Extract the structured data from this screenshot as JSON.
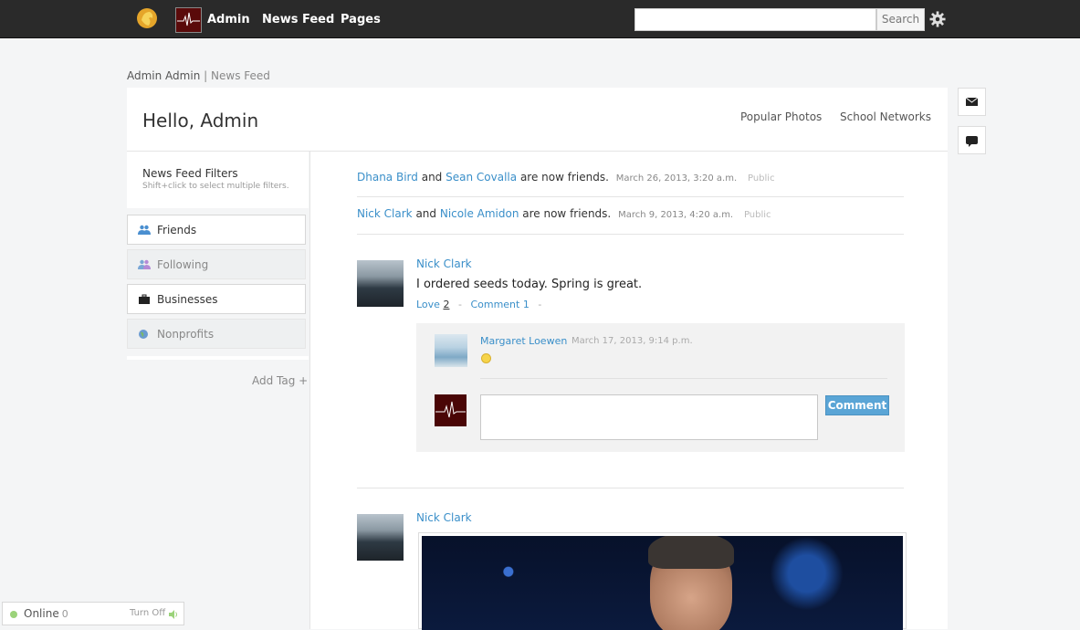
{
  "topbar": {
    "logo_icon": "lion-logo-icon",
    "user_label": "Admin",
    "nav": [
      "News Feed",
      "Pages"
    ],
    "search_placeholder": "",
    "search_button": "Search",
    "settings_icon": "gear-icon"
  },
  "breadcrumb": {
    "user": "Admin Admin",
    "separator": "|",
    "page": "News Feed"
  },
  "header": {
    "greeting": "Hello, Admin",
    "links": [
      "Popular Photos",
      "School Networks"
    ]
  },
  "side_buttons": [
    "envelope-icon",
    "chat-bubble-icon"
  ],
  "filters": {
    "title": "News Feed Filters",
    "subtitle": "Shift+click to select multiple filters.",
    "items": [
      {
        "label": "Friends",
        "icon": "friends-icon",
        "active": true
      },
      {
        "label": "Following",
        "icon": "following-icon",
        "active": false
      },
      {
        "label": "Businesses",
        "icon": "briefcase-icon",
        "active": true
      },
      {
        "label": "Nonprofits",
        "icon": "globe-icon",
        "active": false
      }
    ],
    "add_tag": "Add Tag +"
  },
  "stories": [
    {
      "name1": "Dhana Bird",
      "and": "and",
      "name2": "Sean Covalla",
      "text": "are now friends.",
      "time": "March 26, 2013, 3:20 a.m.",
      "privacy": "Public"
    },
    {
      "name1": "Nick Clark",
      "and": "and",
      "name2": "Nicole Amidon",
      "text": "are now friends.",
      "time": "March 9, 2013, 4:20 a.m.",
      "privacy": "Public"
    }
  ],
  "post1": {
    "author": "Nick Clark",
    "text": "I ordered seeds today. Spring is great.",
    "love_label": "Love",
    "love_count": "2",
    "comment_label": "Comment 1",
    "comment": {
      "author": "Margaret Loewen",
      "time": "March 17, 2013, 9:14 p.m.",
      "emoji": "smiley-icon"
    },
    "comment_button": "Comment"
  },
  "post2": {
    "author": "Nick Clark"
  },
  "online_bar": {
    "label": "Online",
    "count": "0",
    "turn_off": "Turn Off",
    "icon": "speaker-icon"
  },
  "colors": {
    "link": "#3a8fc9",
    "topbar": "#2a2a2a",
    "button": "#5aa5d6",
    "online": "#9bd37a"
  }
}
